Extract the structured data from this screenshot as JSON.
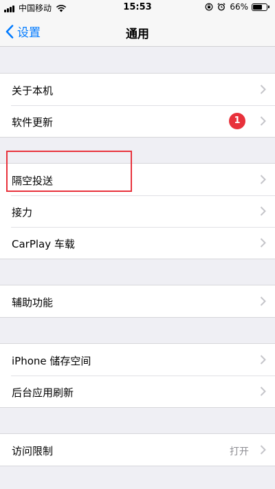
{
  "status_bar": {
    "carrier": "中国移动",
    "time": "15:53",
    "battery": "66%",
    "battery_level": 0.66
  },
  "nav": {
    "back_label": "设置",
    "title": "通用"
  },
  "groups": {
    "g1": [
      {
        "label": "关于本机"
      },
      {
        "label": "软件更新",
        "badge": "1"
      }
    ],
    "g2": [
      {
        "label": "隔空投送"
      },
      {
        "label": "接力"
      },
      {
        "label": "CarPlay 车载"
      }
    ],
    "g3": [
      {
        "label": "辅助功能"
      }
    ],
    "g4": [
      {
        "label": "iPhone 储存空间"
      },
      {
        "label": "后台应用刷新"
      }
    ],
    "g5": [
      {
        "label": "访问限制",
        "detail": "打开"
      }
    ]
  },
  "colors": {
    "accent": "#007aff",
    "badge": "#e8313b",
    "highlight": "#e8313b",
    "background": "#efeff4"
  },
  "icons": [
    "signal-icon",
    "wifi-icon",
    "orientation-lock-icon",
    "alarm-icon",
    "battery-icon",
    "back-chevron-icon",
    "chevron-right-icon"
  ]
}
